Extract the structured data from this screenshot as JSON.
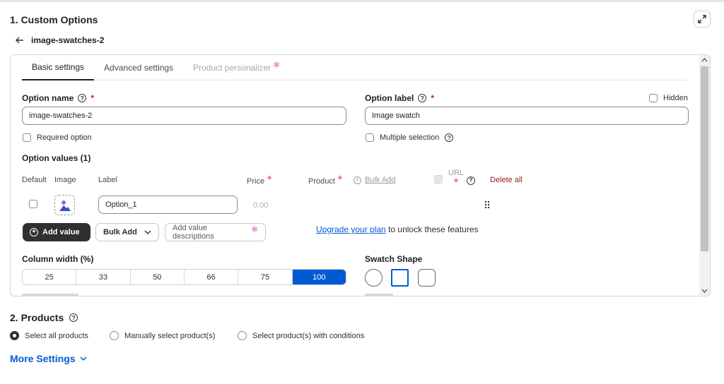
{
  "section1": {
    "title": "1. Custom Options",
    "back_label": "image-swatches-2"
  },
  "tabs": [
    {
      "label": "Basic settings"
    },
    {
      "label": "Advanced settings"
    },
    {
      "label": "Product personalizer"
    }
  ],
  "form": {
    "option_name_label": "Option name",
    "option_name_value": "image-swatches-2",
    "option_label_label": "Option label",
    "option_label_value": "Image swatch",
    "hidden_label": "Hidden",
    "required_option_label": "Required option",
    "multiple_selection_label": "Multiple selection",
    "option_values_title": "Option values (1)"
  },
  "values_table": {
    "columns": {
      "default": "Default",
      "image": "Image",
      "label": "Label",
      "price": "Price",
      "product": "Product",
      "bulk_add": "Bulk Add",
      "url": "URL",
      "delete_all": "Delete all"
    },
    "rows": [
      {
        "label": "Option_1",
        "price": "0.00"
      }
    ]
  },
  "buttons": {
    "add_value": "Add value",
    "bulk_add": "Bulk Add",
    "add_value_descriptions": "Add value descriptions"
  },
  "upgrade": {
    "link": "Upgrade your plan",
    "rest": "to unlock these features"
  },
  "column_width": {
    "title": "Column width (%)",
    "options": [
      "25",
      "33",
      "50",
      "66",
      "75",
      "100"
    ],
    "selected": "100"
  },
  "swatch_shape": {
    "title": "Swatch Shape",
    "selected": "square"
  },
  "section2": {
    "title": "2. Products",
    "radios": [
      {
        "label": "Select all products",
        "selected": true
      },
      {
        "label": "Manually select product(s)",
        "selected": false
      },
      {
        "label": "Select product(s) with conditions",
        "selected": false
      }
    ]
  },
  "more_settings": "More Settings",
  "colors": {
    "accent": "#005bd3",
    "dark_button": "#303030",
    "required": "#c0221f",
    "delete": "#8e1f0b",
    "pink_star": "#e79ad7"
  }
}
